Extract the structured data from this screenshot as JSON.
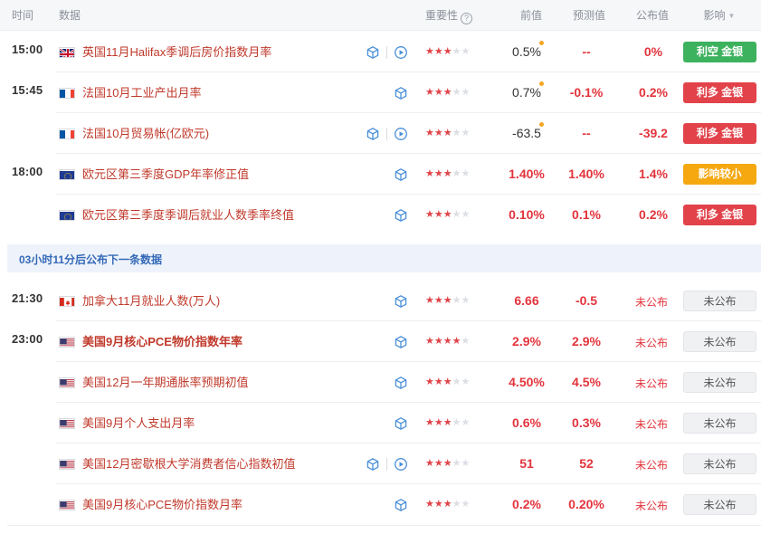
{
  "header": {
    "time": "时间",
    "data": "数据",
    "importance": "重要性",
    "help_glyph": "?",
    "previous": "前值",
    "forecast": "预测值",
    "actual": "公布值",
    "impact": "影响"
  },
  "banner": {
    "text": "03小时11分后公布下一条数据"
  },
  "colors": {
    "accent_red": "#e3343c",
    "event_text": "#c0392b",
    "badge_green": "#3db25e",
    "badge_red": "#e2424a",
    "badge_orange": "#f5a80f",
    "banner_text": "#3469b8"
  },
  "rows": [
    {
      "time": "15:00",
      "country": "UK",
      "flag": "uk-flag-icon",
      "event": "英国11月Halifax季调后房价指数月率",
      "bold": false,
      "icons": [
        "cube-icon",
        "play-icon"
      ],
      "stars": 3,
      "previous": "0.5%",
      "previous_dot": true,
      "forecast": "--",
      "actual": "0%",
      "impact": "利空 金银",
      "impact_type": "green"
    },
    {
      "time": "15:45",
      "country": "FR",
      "flag": "france-flag-icon",
      "event": "法国10月工业产出月率",
      "bold": false,
      "icons": [
        "cube-icon"
      ],
      "stars": 3,
      "previous": "0.7%",
      "previous_dot": true,
      "forecast": "-0.1%",
      "actual": "0.2%",
      "impact": "利多 金银",
      "impact_type": "red"
    },
    {
      "time": "",
      "country": "FR",
      "flag": "france-flag-icon",
      "event": "法国10月贸易帐(亿欧元)",
      "bold": false,
      "icons": [
        "cube-icon",
        "play-icon"
      ],
      "stars": 3,
      "previous": "-63.5",
      "previous_dot": true,
      "forecast": "--",
      "actual": "-39.2",
      "impact": "利多 金银",
      "impact_type": "red"
    },
    {
      "time": "18:00",
      "country": "EU",
      "flag": "eu-flag-icon",
      "event": "欧元区第三季度GDP年率修正值",
      "bold": false,
      "icons": [
        "cube-icon"
      ],
      "stars": 3,
      "previous": "1.40%",
      "previous_dot": false,
      "forecast": "1.40%",
      "actual": "1.4%",
      "impact": "影响较小",
      "impact_type": "orange"
    },
    {
      "time": "",
      "country": "EU",
      "flag": "eu-flag-icon",
      "event": "欧元区第三季度季调后就业人数季率终值",
      "bold": false,
      "icons": [
        "cube-icon"
      ],
      "stars": 3,
      "previous": "0.10%",
      "previous_dot": false,
      "forecast": "0.1%",
      "actual": "0.2%",
      "impact": "利多 金银",
      "impact_type": "red"
    },
    {
      "time": "21:30",
      "country": "CA",
      "flag": "canada-flag-icon",
      "event": "加拿大11月就业人数(万人)",
      "bold": false,
      "icons": [
        "cube-icon"
      ],
      "stars": 3,
      "previous": "6.66",
      "previous_dot": false,
      "forecast": "-0.5",
      "actual": "未公布",
      "impact": "未公布",
      "impact_type": "gray"
    },
    {
      "time": "23:00",
      "country": "US",
      "flag": "us-flag-icon",
      "event": "美国9月核心PCE物价指数年率",
      "bold": true,
      "icons": [
        "cube-icon"
      ],
      "stars": 4,
      "previous": "2.9%",
      "previous_dot": false,
      "forecast": "2.9%",
      "actual": "未公布",
      "impact": "未公布",
      "impact_type": "gray"
    },
    {
      "time": "",
      "country": "US",
      "flag": "us-flag-icon",
      "event": "美国12月一年期通胀率预期初值",
      "bold": false,
      "icons": [
        "cube-icon"
      ],
      "stars": 3,
      "previous": "4.50%",
      "previous_dot": false,
      "forecast": "4.5%",
      "actual": "未公布",
      "impact": "未公布",
      "impact_type": "gray"
    },
    {
      "time": "",
      "country": "US",
      "flag": "us-flag-icon",
      "event": "美国9月个人支出月率",
      "bold": false,
      "icons": [
        "cube-icon"
      ],
      "stars": 3,
      "previous": "0.6%",
      "previous_dot": false,
      "forecast": "0.3%",
      "actual": "未公布",
      "impact": "未公布",
      "impact_type": "gray"
    },
    {
      "time": "",
      "country": "US",
      "flag": "us-flag-icon",
      "event": "美国12月密歇根大学消费者信心指数初值",
      "bold": false,
      "icons": [
        "cube-icon",
        "play-icon"
      ],
      "stars": 3,
      "previous": "51",
      "previous_dot": false,
      "forecast": "52",
      "actual": "未公布",
      "impact": "未公布",
      "impact_type": "gray"
    },
    {
      "time": "",
      "country": "US",
      "flag": "us-flag-icon",
      "event": "美国9月核心PCE物价指数月率",
      "bold": false,
      "icons": [
        "cube-icon"
      ],
      "stars": 3,
      "previous": "0.2%",
      "previous_dot": false,
      "forecast": "0.20%",
      "actual": "未公布",
      "impact": "未公布",
      "impact_type": "gray"
    }
  ]
}
